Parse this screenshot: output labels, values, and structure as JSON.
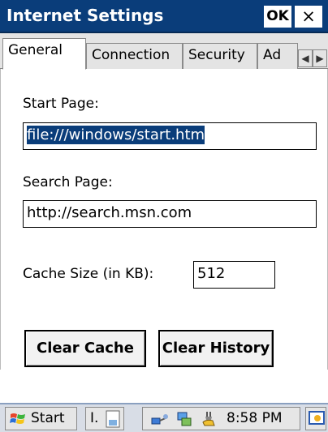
{
  "window": {
    "title": "Internet Settings",
    "ok_label": "OK",
    "close_label": "×"
  },
  "tabs": [
    {
      "label": "General",
      "active": true
    },
    {
      "label": "Connection",
      "active": false
    },
    {
      "label": "Security",
      "active": false
    },
    {
      "label": "Ad",
      "active": false
    }
  ],
  "general": {
    "start_page_label": "Start Page:",
    "start_page_value": "file:///windows/start.htm",
    "search_page_label": "Search Page:",
    "search_page_value": "http://search.msn.com",
    "cache_label": "Cache Size (in KB):",
    "cache_value": "512",
    "clear_cache_label": "Clear Cache",
    "clear_history_label": "Clear History"
  },
  "taskbar": {
    "start_label": "Start",
    "task_label": "I.",
    "clock": "8:58 PM",
    "icons": [
      "windows-flag-icon",
      "network-icon",
      "sync-icon",
      "power-icon",
      "desktop-icon"
    ]
  },
  "colors": {
    "title_bar": "#0a3d7a",
    "selection": "#0a3d7a",
    "taskbar": "#d8dde6"
  }
}
